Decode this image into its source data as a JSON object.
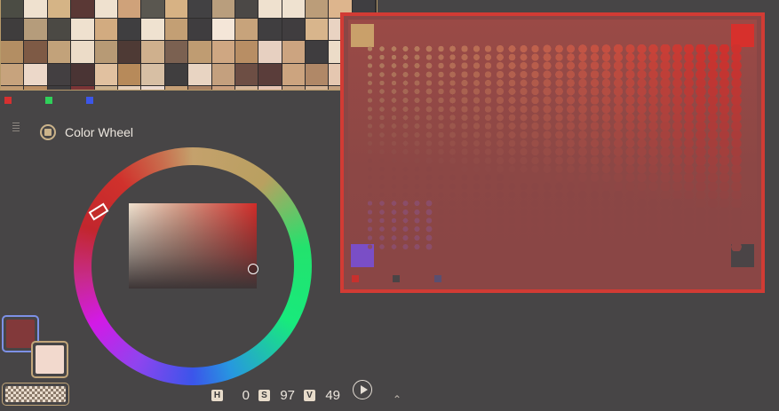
{
  "title": "Color Wheel",
  "palette_colors": [
    "#4b4c44",
    "#efe1cf",
    "#d5b486",
    "#5a3835",
    "#efe1cf",
    "#cfa27a",
    "#5a5750",
    "#d7b284",
    "#424143",
    "#b99e7d",
    "#4b4846",
    "#efe1cf",
    "#efe2d0",
    "#bb9d79",
    "#ddb58d",
    "#3f3e41",
    "#3f3d3d",
    "#b59c7b",
    "#4b4944",
    "#efe1cf",
    "#d2ab80",
    "#3f3e40",
    "#efe2d0",
    "#c39f74",
    "#3f3d3f",
    "#f4e6d8",
    "#c7a37b",
    "#403e40",
    "#403d3f",
    "#d8b58c",
    "#e9d3c2",
    "#403d3f",
    "#b38e63",
    "#7e5a45",
    "#c2a27a",
    "#ecdcc8",
    "#b79a75",
    "#4e3a35",
    "#cfb08d",
    "#7b6151",
    "#bf9c72",
    "#cfa782",
    "#b88e64",
    "#e7d0c1",
    "#cca480",
    "#3f3d3f",
    "#ecdcc8",
    "#403d3f",
    "#c7a37d",
    "#ecd8c9",
    "#433f41",
    "#4a3434",
    "#e1c1a0",
    "#b78a5a",
    "#d7bfa4",
    "#403e3f",
    "#e8d4c2",
    "#c4a07e",
    "#6d4e44",
    "#5a3d3a",
    "#cca47f",
    "#b08867",
    "#e5c7b0",
    "#d1ab86",
    "#c29b72",
    "#bb8e63",
    "#3f3d3f",
    "#7b3436",
    "#ccb28e",
    "#e6cfb9",
    "#ecdad1",
    "#c69f76",
    "#a98061",
    "#ca9f7e",
    "#d7b79a",
    "#e5c4b3",
    "#c9a584",
    "#d6b494",
    "#c4a07e",
    "#ad8463"
  ],
  "palette_dot_colors": [
    "#d63030",
    "#2fd05a",
    "#3c56e8"
  ],
  "current_color": "#82393a",
  "secondary_color": "#f2d9cd",
  "hsv": {
    "h_label": "H",
    "h_value": "0",
    "s_label": "S",
    "s_value": "97",
    "v_label": "V",
    "v_value": "49"
  },
  "panel": {
    "border_color": "#d23b34",
    "corner_top_left": "#c9a06a",
    "corner_top_right": "#d7302c",
    "corner_bottom_left": "#7a4ec6",
    "corner_bottom_right": "#4a4446",
    "dot_colors": [
      "#c8302d",
      "#4a4446",
      "#5a4f70"
    ]
  },
  "icons": {
    "title_icon": "color-wheel-icon",
    "play": "play-icon",
    "chevron": "chevron-up-icon",
    "grip": "grip-icon",
    "alpha": "checkerboard-icon"
  }
}
